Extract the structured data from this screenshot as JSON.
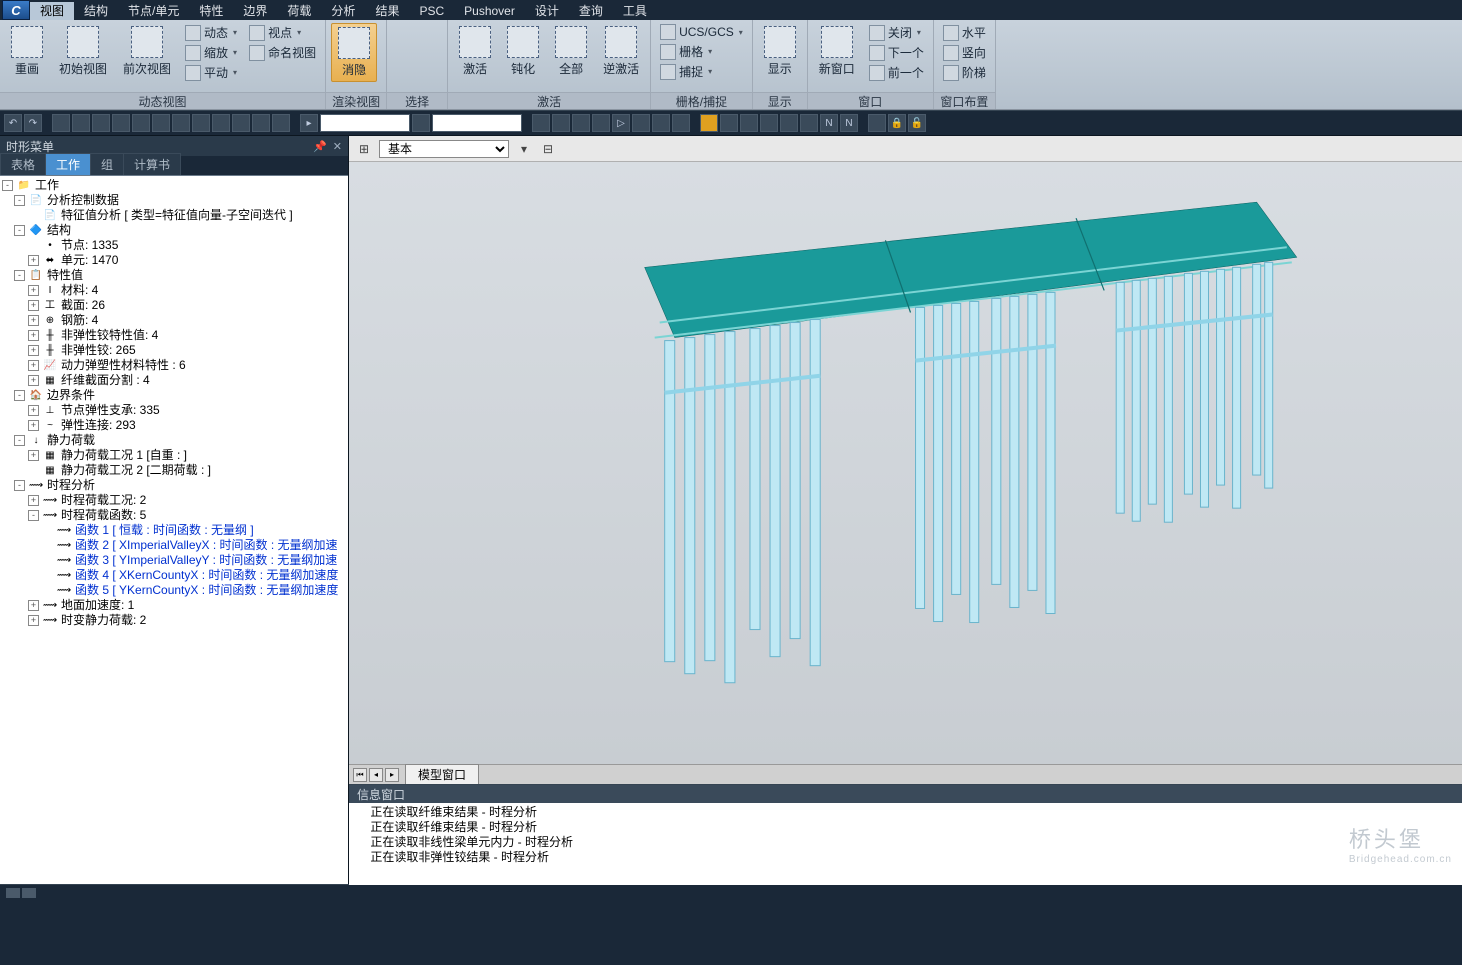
{
  "menu": [
    "视图",
    "结构",
    "节点/单元",
    "特性",
    "边界",
    "荷载",
    "分析",
    "结果",
    "PSC",
    "Pushover",
    "设计",
    "查询",
    "工具"
  ],
  "menu_active": 0,
  "ribbon": {
    "groups": [
      {
        "label": "动态视图",
        "big": [
          {
            "name": "redraw",
            "lbl": "重画"
          },
          {
            "name": "initial-view",
            "lbl": "初始视图"
          },
          {
            "name": "prev-view",
            "lbl": "前次视图"
          }
        ],
        "cols": [
          [
            {
              "ic": "dyn",
              "lbl": "动态",
              "dd": true
            },
            {
              "ic": "zoom",
              "lbl": "缩放",
              "dd": true
            },
            {
              "ic": "pan",
              "lbl": "平动",
              "dd": true
            }
          ],
          [
            {
              "ic": "vp",
              "lbl": "视点",
              "dd": true
            },
            {
              "ic": "nv",
              "lbl": "命名视图"
            }
          ]
        ]
      },
      {
        "label": "渲染视图",
        "active": true,
        "big": [
          {
            "name": "hide",
            "lbl": "消隐"
          }
        ],
        "side_icons": 3
      },
      {
        "label": "选择",
        "icons": 6
      },
      {
        "label": "激活",
        "big": [
          {
            "name": "activate",
            "lbl": "激活"
          },
          {
            "name": "passivate",
            "lbl": "钝化"
          },
          {
            "name": "all",
            "lbl": "全部"
          },
          {
            "name": "reverse",
            "lbl": "逆激活"
          }
        ]
      },
      {
        "label": "栅格/捕捉",
        "cols": [
          [
            {
              "ic": "ucs",
              "lbl": "UCS/GCS",
              "dd": true
            },
            {
              "ic": "grid",
              "lbl": "栅格",
              "dd": true
            },
            {
              "ic": "snap",
              "lbl": "捕捉",
              "dd": true
            }
          ]
        ]
      },
      {
        "label": "显示",
        "big": [
          {
            "name": "display",
            "lbl": "显示"
          }
        ]
      },
      {
        "label": "窗口",
        "big": [
          {
            "name": "new-win",
            "lbl": "新窗口"
          }
        ],
        "cols": [
          [
            {
              "ic": "close",
              "lbl": "关闭",
              "dd": true
            },
            {
              "ic": "next",
              "lbl": "下一个"
            },
            {
              "ic": "prev",
              "lbl": "前一个"
            }
          ]
        ]
      },
      {
        "label": "窗口布置",
        "cols": [
          [
            {
              "ic": "horiz",
              "lbl": "水平"
            },
            {
              "ic": "vert",
              "lbl": "竖向"
            },
            {
              "ic": "stairs",
              "lbl": "阶梯"
            }
          ]
        ]
      }
    ]
  },
  "left_panel": {
    "title": "时形菜单",
    "tabs": [
      "表格",
      "工作",
      "组",
      "计算书"
    ],
    "active_tab": 1
  },
  "tree": [
    {
      "lvl": 0,
      "exp": "-",
      "ic": "📁",
      "txt": "工作"
    },
    {
      "lvl": 1,
      "exp": "-",
      "ic": "📄",
      "txt": "分析控制数据"
    },
    {
      "lvl": 2,
      "exp": " ",
      "ic": "📄",
      "txt": "特征值分析 [ 类型=特征值向量-子空间迭代 ]"
    },
    {
      "lvl": 1,
      "exp": "-",
      "ic": "🔷",
      "txt": "结构"
    },
    {
      "lvl": 2,
      "exp": " ",
      "ic": "•",
      "txt": "节点: 1335"
    },
    {
      "lvl": 2,
      "exp": "+",
      "ic": "⬌",
      "txt": "单元: 1470"
    },
    {
      "lvl": 1,
      "exp": "-",
      "ic": "📋",
      "txt": "特性值"
    },
    {
      "lvl": 2,
      "exp": "+",
      "ic": "I",
      "txt": "材料: 4"
    },
    {
      "lvl": 2,
      "exp": "+",
      "ic": "工",
      "txt": "截面: 26"
    },
    {
      "lvl": 2,
      "exp": "+",
      "ic": "⊕",
      "txt": "钢筋: 4"
    },
    {
      "lvl": 2,
      "exp": "+",
      "ic": "╫",
      "txt": "非弹性铰特性值: 4"
    },
    {
      "lvl": 2,
      "exp": "+",
      "ic": "╫",
      "txt": "非弹性铰: 265"
    },
    {
      "lvl": 2,
      "exp": "+",
      "ic": "📈",
      "txt": "动力弹塑性材料特性 : 6"
    },
    {
      "lvl": 2,
      "exp": "+",
      "ic": "▦",
      "txt": "纤维截面分割 : 4"
    },
    {
      "lvl": 1,
      "exp": "-",
      "ic": "🏠",
      "txt": "边界条件"
    },
    {
      "lvl": 2,
      "exp": "+",
      "ic": "⊥",
      "txt": "节点弹性支承: 335"
    },
    {
      "lvl": 2,
      "exp": "+",
      "ic": "~",
      "txt": "弹性连接: 293"
    },
    {
      "lvl": 1,
      "exp": "-",
      "ic": "↓",
      "txt": "静力荷载"
    },
    {
      "lvl": 2,
      "exp": "+",
      "ic": "▦",
      "txt": "静力荷载工况 1 [自重 : ]"
    },
    {
      "lvl": 2,
      "exp": " ",
      "ic": "▦",
      "txt": "静力荷载工况 2 [二期荷载 : ]"
    },
    {
      "lvl": 1,
      "exp": "-",
      "ic": "⟿",
      "txt": "时程分析"
    },
    {
      "lvl": 2,
      "exp": "+",
      "ic": "⟿",
      "txt": "时程荷载工况: 2"
    },
    {
      "lvl": 2,
      "exp": "-",
      "ic": "⟿",
      "txt": "时程荷载函数: 5"
    },
    {
      "lvl": 3,
      "exp": " ",
      "ic": "⟿",
      "txt": "函数 1 [ 恒载 : 时间函数 : 无量纲 ]",
      "link": true
    },
    {
      "lvl": 3,
      "exp": " ",
      "ic": "⟿",
      "txt": "函数 2 [ XImperialValleyX : 时间函数 : 无量纲加速",
      "link": true
    },
    {
      "lvl": 3,
      "exp": " ",
      "ic": "⟿",
      "txt": "函数 3 [ YImperialValleyY : 时间函数 : 无量纲加速",
      "link": true
    },
    {
      "lvl": 3,
      "exp": " ",
      "ic": "⟿",
      "txt": "函数 4 [ XKernCountyX : 时间函数 : 无量纲加速度",
      "link": true
    },
    {
      "lvl": 3,
      "exp": " ",
      "ic": "⟿",
      "txt": "函数 5 [ YKernCountyX : 时间函数 : 无量纲加速度",
      "link": true
    },
    {
      "lvl": 2,
      "exp": "+",
      "ic": "⟿",
      "txt": "地面加速度: 1"
    },
    {
      "lvl": 2,
      "exp": "+",
      "ic": "⟿",
      "txt": "时变静力荷载: 2"
    }
  ],
  "view_toolbar": {
    "mode": "基本"
  },
  "view_tab": "模型窗口",
  "msg_panel": {
    "title": "信息窗口",
    "lines": [
      "    正在读取纤维束结果 - 时程分析",
      "    正在读取纤维束结果 - 时程分析",
      "    正在读取非线性梁单元内力 - 时程分析",
      "    正在读取非弹性铰结果 - 时程分析"
    ]
  },
  "watermark": "桥头堡",
  "watermark_sub": "Bridgehead.com.cn"
}
